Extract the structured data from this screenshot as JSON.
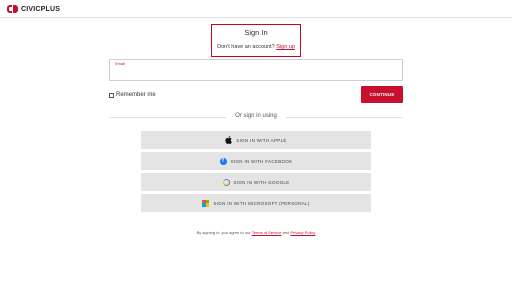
{
  "header": {
    "brand_civic": "CIVIC",
    "brand_plus": "PLUS"
  },
  "signin": {
    "title": "Sign In",
    "no_account_text": "Don't have an account?",
    "signup_link": "Sign up"
  },
  "form": {
    "email_label": "Email",
    "email_value": "",
    "remember_label": "Remember me",
    "continue_label": "CONTINUE"
  },
  "divider": {
    "text": "Or sign in using"
  },
  "sso": {
    "apple": {
      "label": "SIGN IN WITH APPLE",
      "icon": "apple-icon"
    },
    "facebook": {
      "label": "SIGN IN WITH FACEBOOK",
      "icon": "facebook-icon",
      "icon_glyph": "f"
    },
    "google": {
      "label": "SIGN IN WITH GOOGLE",
      "icon": "google-icon"
    },
    "microsoft": {
      "label": "SIGN IN WITH MICROSOFT (PERSONAL)",
      "icon": "microsoft-icon"
    }
  },
  "legal": {
    "prefix": "By signing in, you agree to our",
    "terms": "Terms of Service",
    "and": "and",
    "privacy": "Privacy Policy"
  },
  "colors": {
    "accent": "#c8102e",
    "button_bg": "#e4e4e4",
    "highlight": "#d0021b"
  }
}
